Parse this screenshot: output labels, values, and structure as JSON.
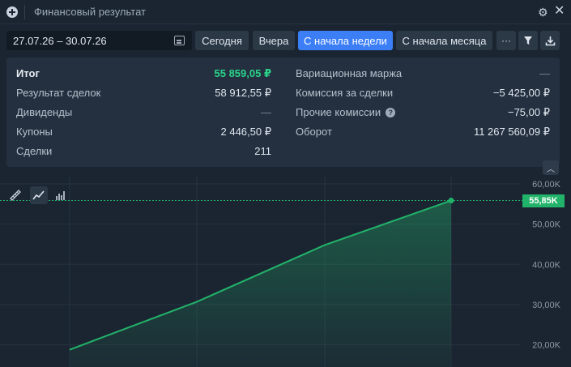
{
  "window": {
    "title": "Финансовый результат"
  },
  "toolbar": {
    "date_range": "27.07.26 – 30.07.26",
    "buttons": [
      "Сегодня",
      "Вчера",
      "С начала недели",
      "С начала месяца"
    ],
    "active_button": "С начала недели",
    "more_label": "···"
  },
  "summary": {
    "left": [
      {
        "label": "Итог",
        "value": "55 859,05 ₽"
      },
      {
        "label": "Результат сделок",
        "value": "58 912,55 ₽"
      },
      {
        "label": "Дивиденды",
        "value": "—"
      },
      {
        "label": "Купоны",
        "value": "2 446,50 ₽"
      },
      {
        "label": "Сделки",
        "value": "211"
      }
    ],
    "right": [
      {
        "label": "Вариационная маржа",
        "value": "—"
      },
      {
        "label": "Комиссия за сделки",
        "value": "−5 425,00 ₽"
      },
      {
        "label": "Прочие комиссии",
        "value": "−75,00 ₽"
      },
      {
        "label": "Оборот",
        "value": "11 267 560,09 ₽"
      }
    ]
  },
  "colors": {
    "accent": "#3b7ef6",
    "positive": "#2bd48a",
    "line": "#22b36a"
  },
  "chart_data": {
    "type": "area",
    "x": [
      0,
      1,
      2,
      3
    ],
    "values": [
      18800,
      30700,
      44800,
      55850
    ],
    "y_ticks": [
      "20,00K",
      "30,00K",
      "40,00K",
      "50,00K",
      "60,00K"
    ],
    "y_tick_values": [
      20000,
      30000,
      40000,
      50000,
      60000
    ],
    "ylim": [
      14500,
      61800
    ],
    "current_value_label": "55,85K",
    "current_value": 55850,
    "grid": true
  }
}
